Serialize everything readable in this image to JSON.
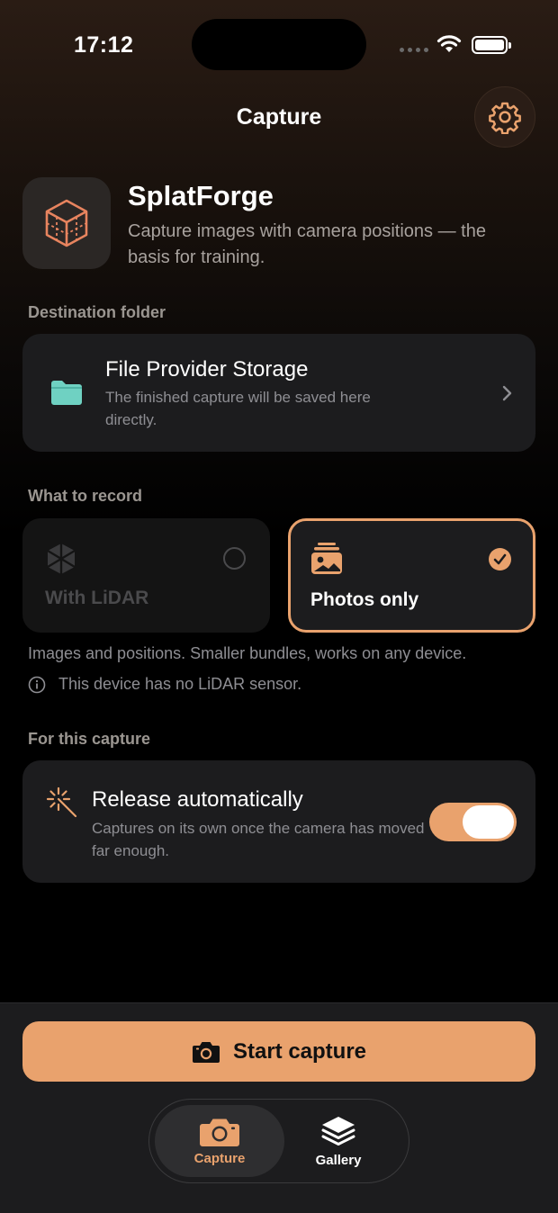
{
  "status": {
    "time": "17:12"
  },
  "nav": {
    "title": "Capture",
    "settings_icon": "gear-icon"
  },
  "app": {
    "name": "SplatForge",
    "description": "Capture images with camera positions — the basis for training."
  },
  "destination": {
    "section_label": "Destination folder",
    "title": "File Provider Storage",
    "description": "The finished capture will be saved here directly."
  },
  "record": {
    "section_label": "What to record",
    "options": [
      {
        "label": "With LiDAR",
        "selected": false,
        "enabled": false
      },
      {
        "label": "Photos only",
        "selected": true,
        "enabled": true
      }
    ],
    "help": "Images and positions. Smaller bundles, works on any device.",
    "notice": "This device has no LiDAR sensor."
  },
  "capture_options": {
    "section_label": "For this capture",
    "title": "Release automatically",
    "description": "Captures on its own once the camera has moved far enough.",
    "enabled": true
  },
  "actions": {
    "start_label": "Start capture"
  },
  "tabs": [
    {
      "label": "Capture",
      "icon": "camera-icon",
      "active": true
    },
    {
      "label": "Gallery",
      "icon": "stack-icon",
      "active": false
    }
  ],
  "colors": {
    "accent": "#e9a26d",
    "folder": "#6fd1c2",
    "card": "#1c1c1e"
  }
}
